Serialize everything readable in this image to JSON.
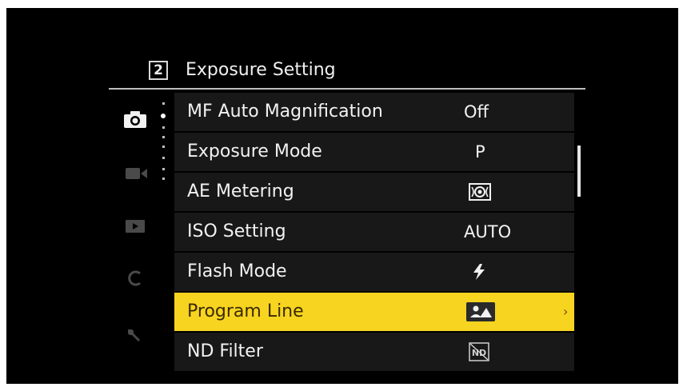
{
  "header": {
    "page_number": "2",
    "title": "Exposure Setting"
  },
  "sidebar": {
    "icons": [
      "camera-icon",
      "video-icon",
      "play-icon",
      "custom-icon",
      "wrench-icon"
    ],
    "active": "camera-icon"
  },
  "menu": {
    "items": [
      {
        "label": "MF Auto Magnification",
        "value": "Off"
      },
      {
        "label": "Exposure Mode",
        "value": "P"
      },
      {
        "label": "AE Metering",
        "value": "",
        "icon": "multi-metering-icon"
      },
      {
        "label": "ISO Setting",
        "value": "AUTO"
      },
      {
        "label": "Flash Mode",
        "value": "",
        "icon": "flash-icon"
      },
      {
        "label": "Program Line",
        "value": "",
        "icon": "program-line-icon",
        "selected": true,
        "submenu": "›"
      },
      {
        "label": "ND Filter",
        "value": "",
        "icon": "nd-filter-off-icon"
      }
    ]
  },
  "colors": {
    "highlight": "#f7d41f",
    "background": "#000000",
    "row": "#181818",
    "text": "#f2f2f2"
  }
}
